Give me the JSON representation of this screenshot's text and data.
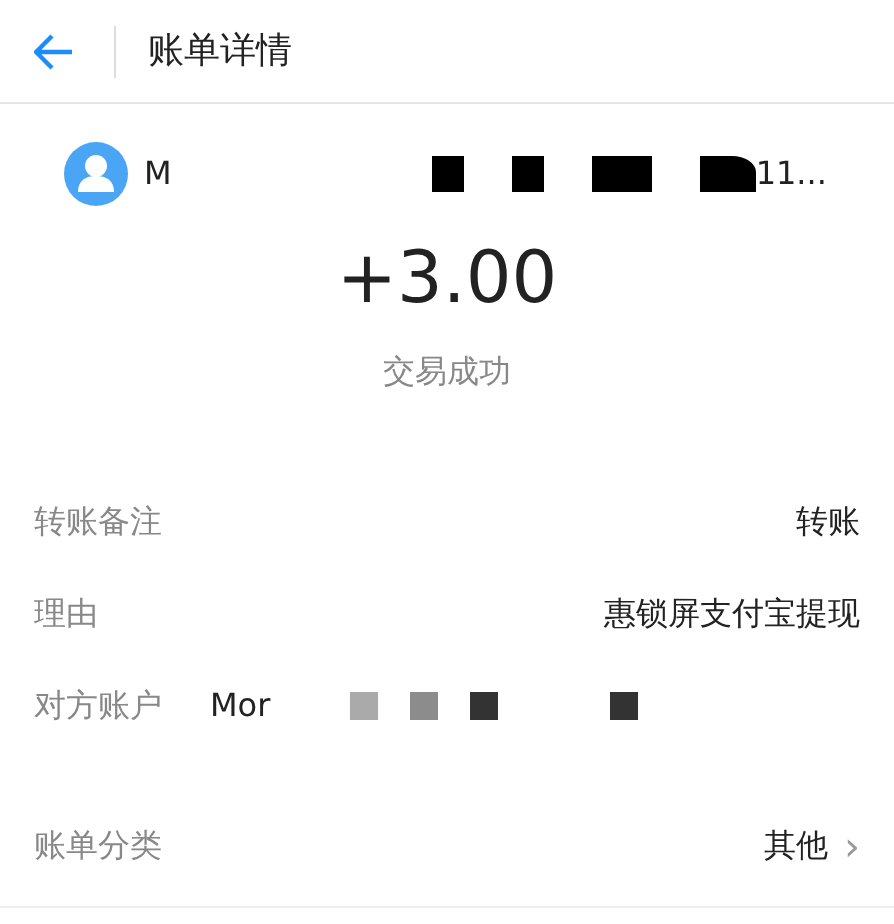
{
  "header": {
    "title": "账单详情"
  },
  "counterparty": {
    "name_start": "M",
    "name_end": "11...",
    "masks": [
      {
        "color": "#000000",
        "kind": "square"
      },
      {
        "color": "#000000",
        "kind": "square"
      },
      {
        "color": "#000000",
        "kind": "wide"
      },
      {
        "color": "#000000",
        "kind": "slant"
      }
    ]
  },
  "amount": "+3.00",
  "status": "交易成功",
  "details": [
    {
      "label": "转账备注",
      "value": "转账"
    },
    {
      "label": "理由",
      "value": "惠锁屏支付宝提现"
    }
  ],
  "account": {
    "label": "对方账户",
    "value_start": "Mor",
    "masks": [
      {
        "color": "#aaaaaa",
        "kind": "square"
      },
      {
        "color": "#8c8c8c",
        "kind": "square"
      },
      {
        "color": "#333333",
        "kind": "square"
      },
      {
        "color": "#333333",
        "kind": "square"
      }
    ]
  },
  "category": {
    "label": "账单分类",
    "value": "其他",
    "chevron": "›"
  }
}
